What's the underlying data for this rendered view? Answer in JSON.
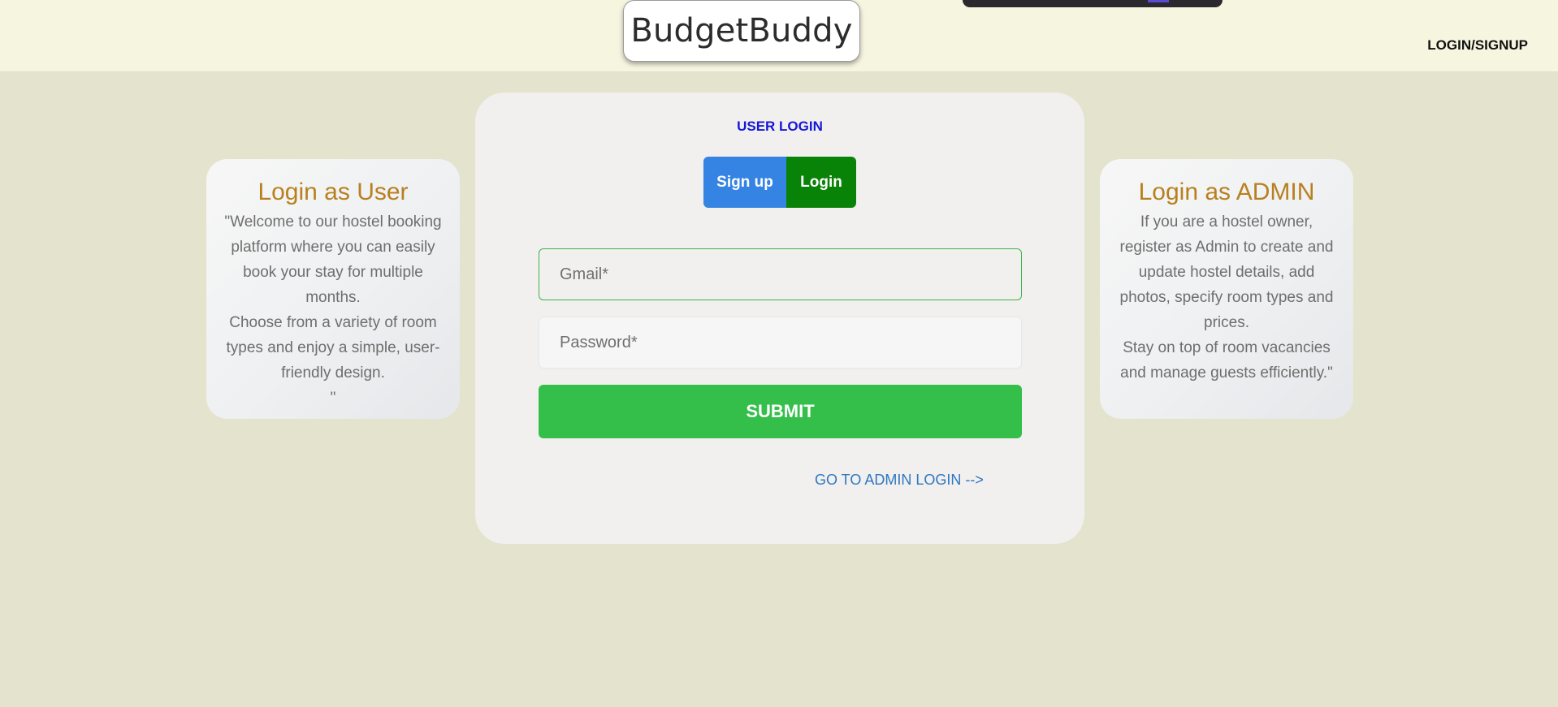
{
  "app": {
    "brand_name": "BudgetBuddy",
    "nav_login_label": "LOGIN/SIGNUP"
  },
  "user_card": {
    "title": "Login as User",
    "text": "\"Welcome to our hostel booking platform where you can easily book your stay for multiple months.\nChoose from a variety of room types and enjoy a simple, user-friendly design.\n\""
  },
  "admin_card": {
    "title": "Login as ADMIN",
    "text": "If you are a hostel owner, register as Admin to create and update hostel details, add photos, specify room types and prices.\nStay on top of room vacancies and manage guests efficiently.\""
  },
  "login_form": {
    "title": "USER LOGIN",
    "signup_tab_label": "Sign up",
    "login_tab_label": "Login",
    "gmail_placeholder": "Gmail*",
    "gmail_value": "",
    "password_placeholder": "Password*",
    "password_value": "",
    "submit_label": "SUBMIT",
    "admin_link_label": "GO TO ADMIN LOGIN -->"
  },
  "colors": {
    "page_background": "#e4e3cd",
    "header_background": "#f6f5e0",
    "card_title": "#b8801f",
    "form_title": "#1616d8",
    "signup_tab": "#3584e4",
    "login_tab_active": "#098307",
    "submit_button": "#33bf4a",
    "link": "#2f77c1"
  }
}
